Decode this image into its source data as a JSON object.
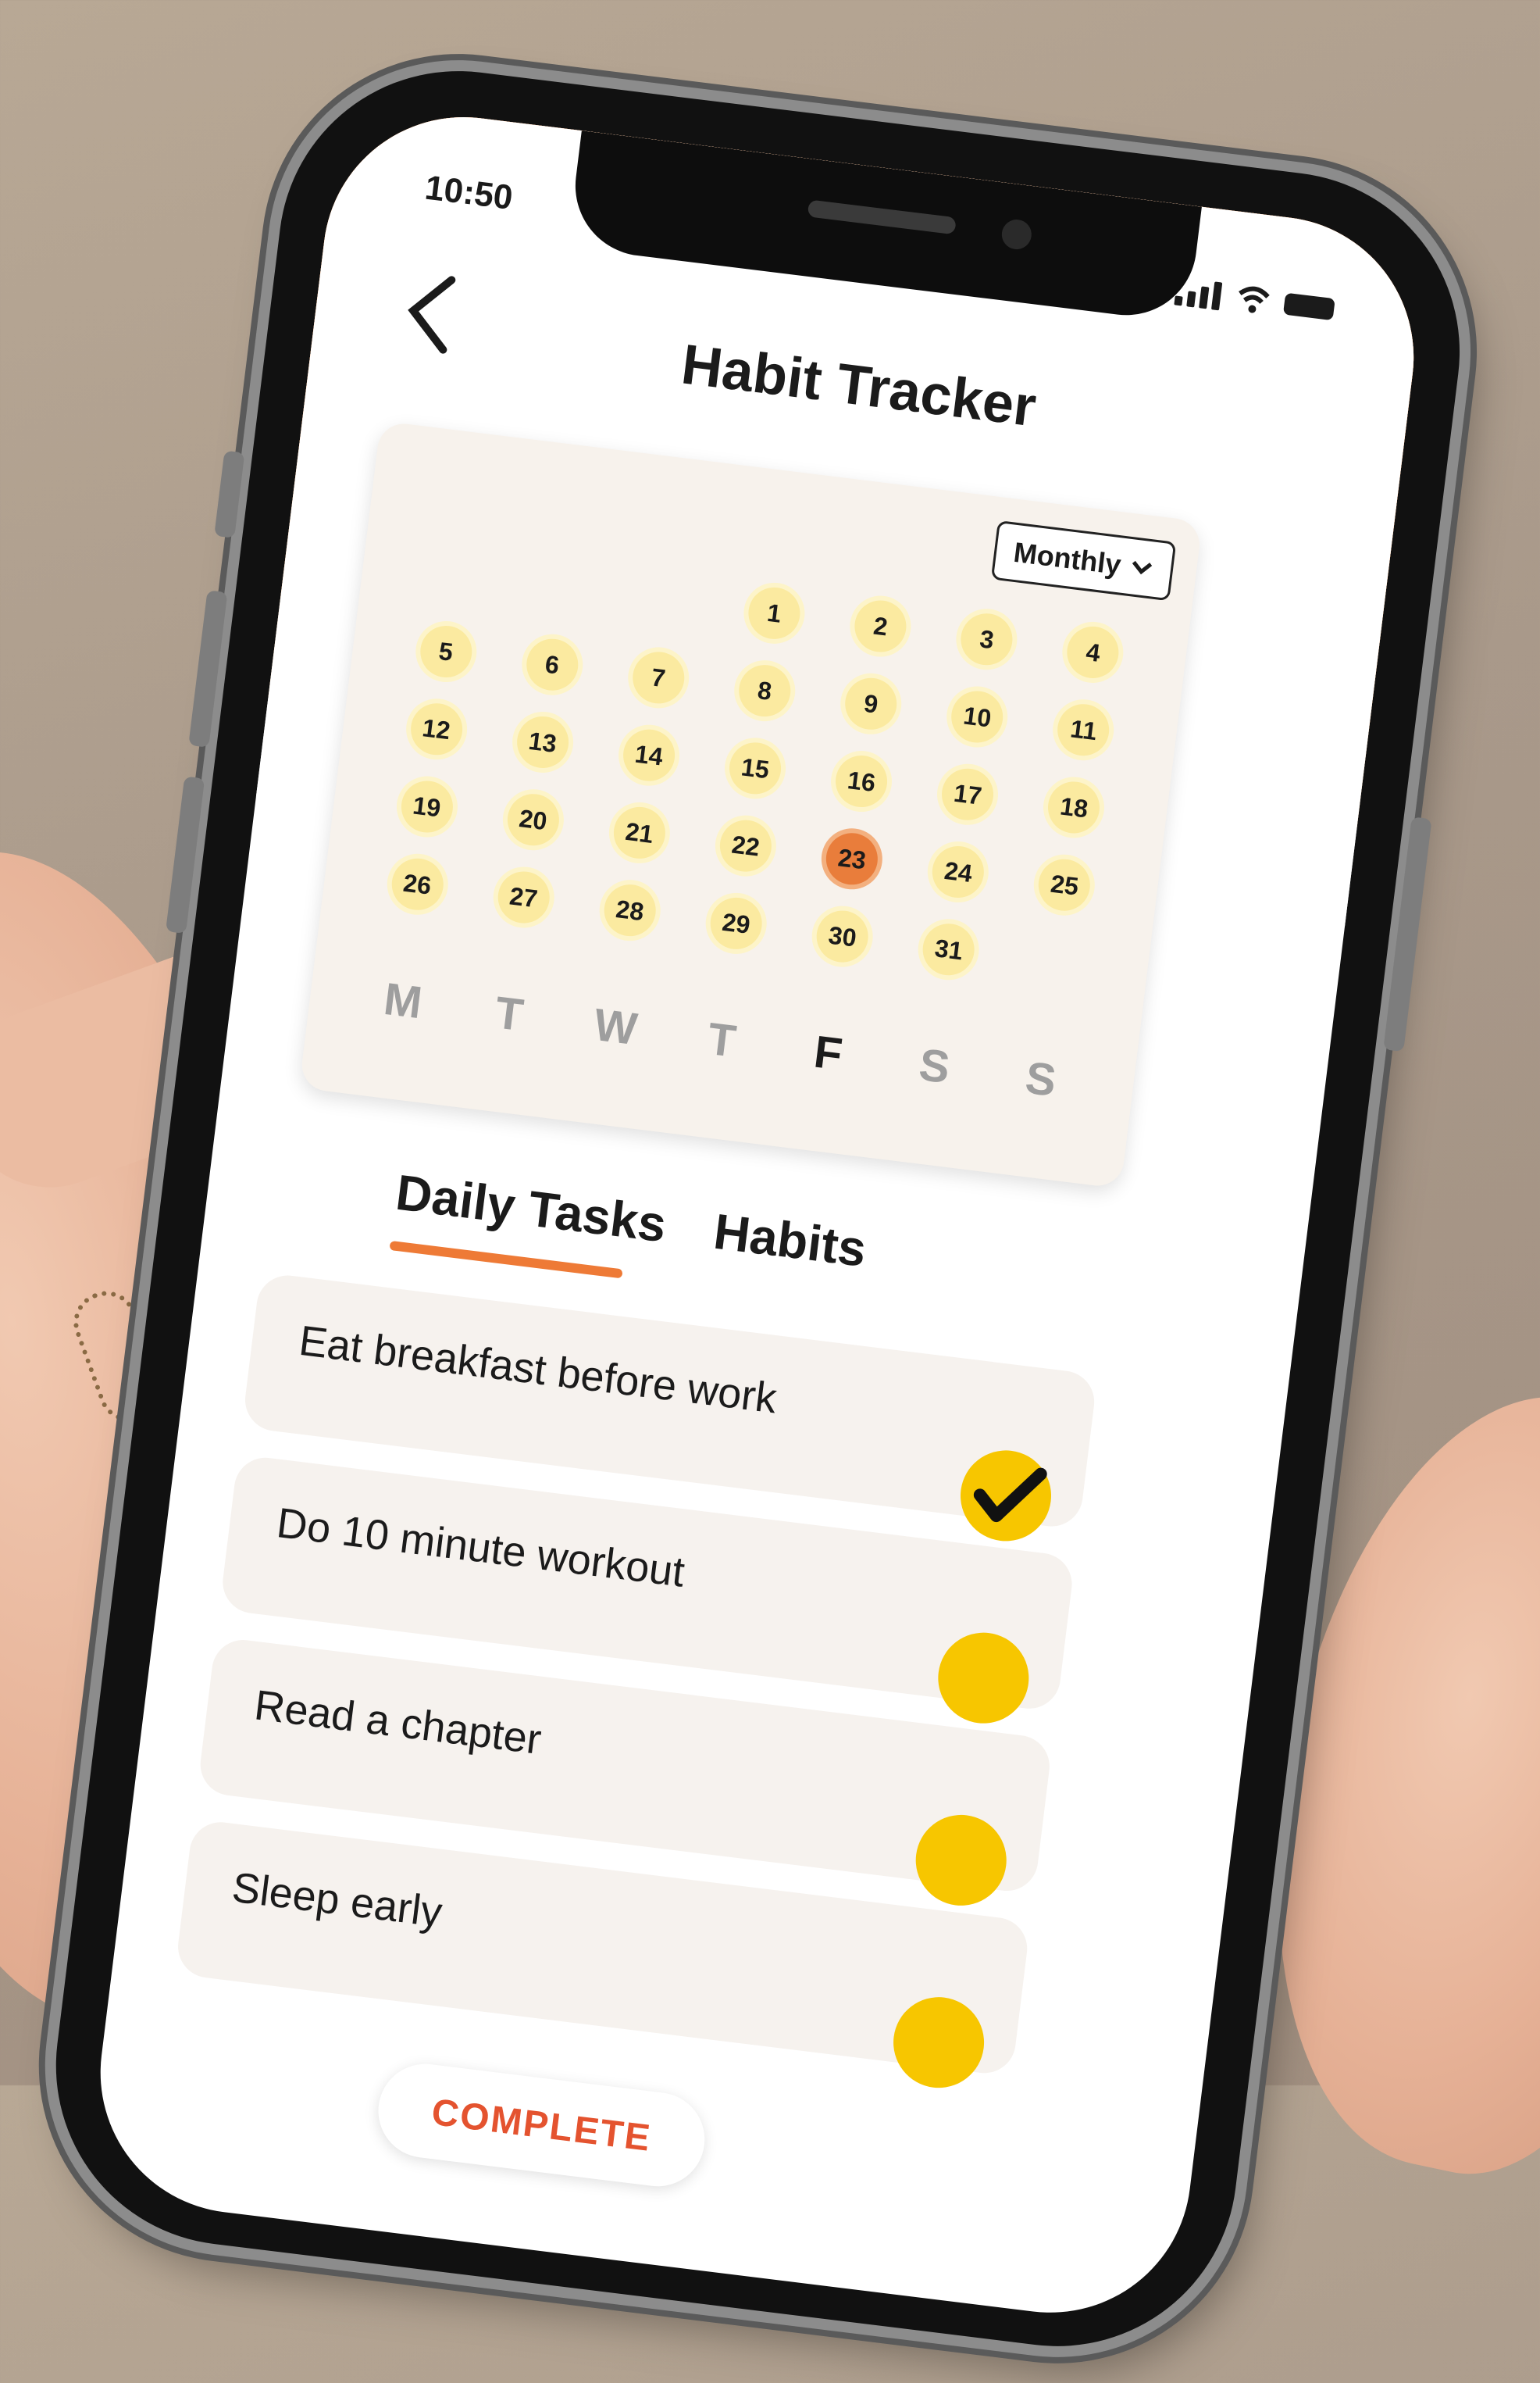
{
  "status_bar": {
    "time": "10:50"
  },
  "header": {
    "title": "Habit Tracker",
    "back_icon": "chevron-left-icon"
  },
  "calendar": {
    "view_toggle": {
      "label": "Monthly",
      "icon": "chevron-down-icon"
    },
    "weekdays": [
      "M",
      "T",
      "W",
      "T",
      "F",
      "S",
      "S"
    ],
    "active_weekday_index": 4,
    "leading_blank_days": 3,
    "days": [
      1,
      2,
      3,
      4,
      5,
      6,
      7,
      8,
      9,
      10,
      11,
      12,
      13,
      14,
      15,
      16,
      17,
      18,
      19,
      20,
      21,
      22,
      23,
      24,
      25,
      26,
      27,
      28,
      29,
      30,
      31
    ],
    "today": 23
  },
  "tabs": [
    {
      "label": "Daily Tasks",
      "active": true
    },
    {
      "label": "Habits",
      "active": false
    }
  ],
  "tasks": [
    {
      "label": "Eat breakfast before work",
      "done": true
    },
    {
      "label": "Do 10 minute workout",
      "done": false
    },
    {
      "label": "Read a chapter",
      "done": false
    },
    {
      "label": "Sleep early",
      "done": false
    }
  ],
  "complete_button": {
    "label": "COMPLETE"
  },
  "colors": {
    "accent_orange": "#e65c2c",
    "accent_mid": "#f0843a",
    "accent_light": "#f6a758",
    "check_yellow": "#f7c600",
    "today_orange": "#e97d3b"
  }
}
